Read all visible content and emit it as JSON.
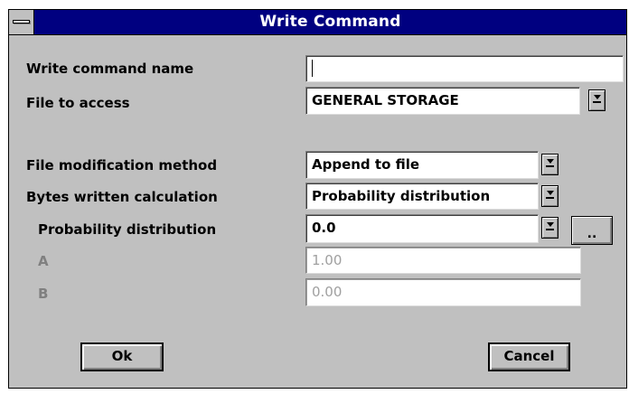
{
  "dialog": {
    "title": "Write Command"
  },
  "form": {
    "write_command_name": {
      "label": "Write command name",
      "value": ""
    },
    "file_to_access": {
      "label": "File to access",
      "value": "GENERAL STORAGE"
    },
    "file_modification_method": {
      "label": "File modification method",
      "value": "Append to file"
    },
    "bytes_written_calculation": {
      "label": "Bytes written calculation",
      "value": "Probability distribution"
    },
    "probability_distribution": {
      "label": "Probability distribution",
      "value": "0.0",
      "more_label": ".."
    },
    "param_a": {
      "label": "A",
      "value": "1.00"
    },
    "param_b": {
      "label": "B",
      "value": "0.00"
    }
  },
  "buttons": {
    "ok": "Ok",
    "cancel": "Cancel"
  },
  "icons": {
    "system_menu": "system-menu-icon",
    "dropdown": "dropdown-arrow-icon"
  },
  "colors": {
    "titlebar": "#000080",
    "dialog_bg": "#c0c0c0",
    "disabled_text": "#808080"
  }
}
